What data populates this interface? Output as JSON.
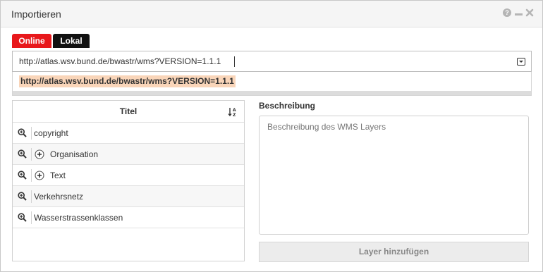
{
  "dialog": {
    "title": "Importieren",
    "controls": {
      "help": "help-icon",
      "minimize": "minimize-icon",
      "close": "close-icon"
    }
  },
  "tabs": [
    {
      "label": "Online",
      "active": true,
      "color": "#e8181b"
    },
    {
      "label": "Lokal",
      "active": false,
      "color": "#111111"
    }
  ],
  "url": {
    "value": "http://atlas.wsv.bund.de/bwastr/wms?VERSION=1.1.1",
    "suggestion": "http://atlas.wsv.bund.de/bwastr/wms?VERSION=1.1.1"
  },
  "layers": {
    "header": "Titel",
    "sort_icon": "sort-alpha-icon",
    "rows": [
      {
        "label": "copyright",
        "expandable": false
      },
      {
        "label": "Organisation",
        "expandable": true
      },
      {
        "label": "Text",
        "expandable": true
      },
      {
        "label": "Verkehrsnetz",
        "expandable": false
      },
      {
        "label": "Wasserstrassenklassen",
        "expandable": false
      }
    ]
  },
  "description": {
    "label": "Beschreibung",
    "placeholder": "Beschreibung des WMS Layers"
  },
  "add_button": {
    "label": "Layer hinzufügen"
  },
  "colors": {
    "accent_online": "#e8181b",
    "highlight": "#f9d5b9"
  }
}
